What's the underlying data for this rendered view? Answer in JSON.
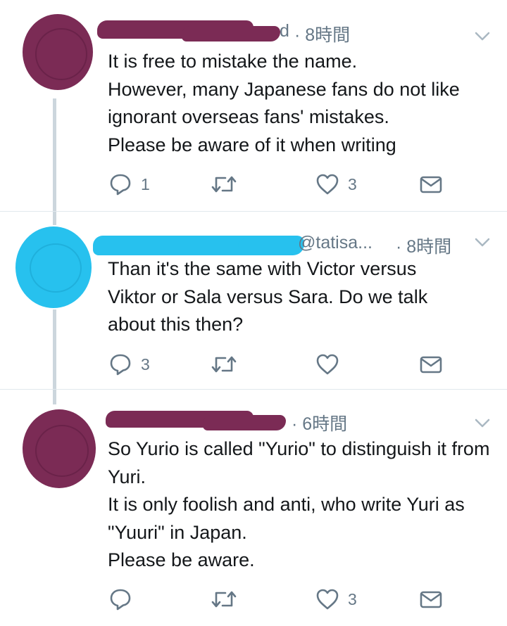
{
  "tweets": [
    {
      "handle_suffix": "d",
      "time": "· 8時間",
      "text": "It is free to mistake the name.\nHowever, many Japanese fans do not like ignorant overseas fans' mistakes.\nPlease be aware of it when writing",
      "replies": "1",
      "retweets": "",
      "likes": "3"
    },
    {
      "handle_suffix": "@tatisa...",
      "time": "· 8時間",
      "text": "Than it's the same with Victor versus Viktor or Sala versus Sara. Do we talk about this then?",
      "replies": "3",
      "retweets": "",
      "likes": ""
    },
    {
      "handle_suffix": "",
      "time": "· 6時間",
      "text": "So Yurio is called \"Yurio\" to distinguish it from Yuri.\nIt is only foolish and anti, who write Yuri as \"Yuuri\" in Japan.\nPlease be aware.",
      "replies": "",
      "retweets": "",
      "likes": "3"
    }
  ],
  "icons": {
    "reply": "reply-icon",
    "retweet": "retweet-icon",
    "like": "heart-icon",
    "dm": "envelope-icon",
    "menu": "chevron-down-icon"
  },
  "colors": {
    "text": "#14171a",
    "muted": "#657786",
    "redaction_purple": "#7b2b55",
    "redaction_blue": "#27c1ee",
    "thread_line": "#ccd6dd"
  }
}
